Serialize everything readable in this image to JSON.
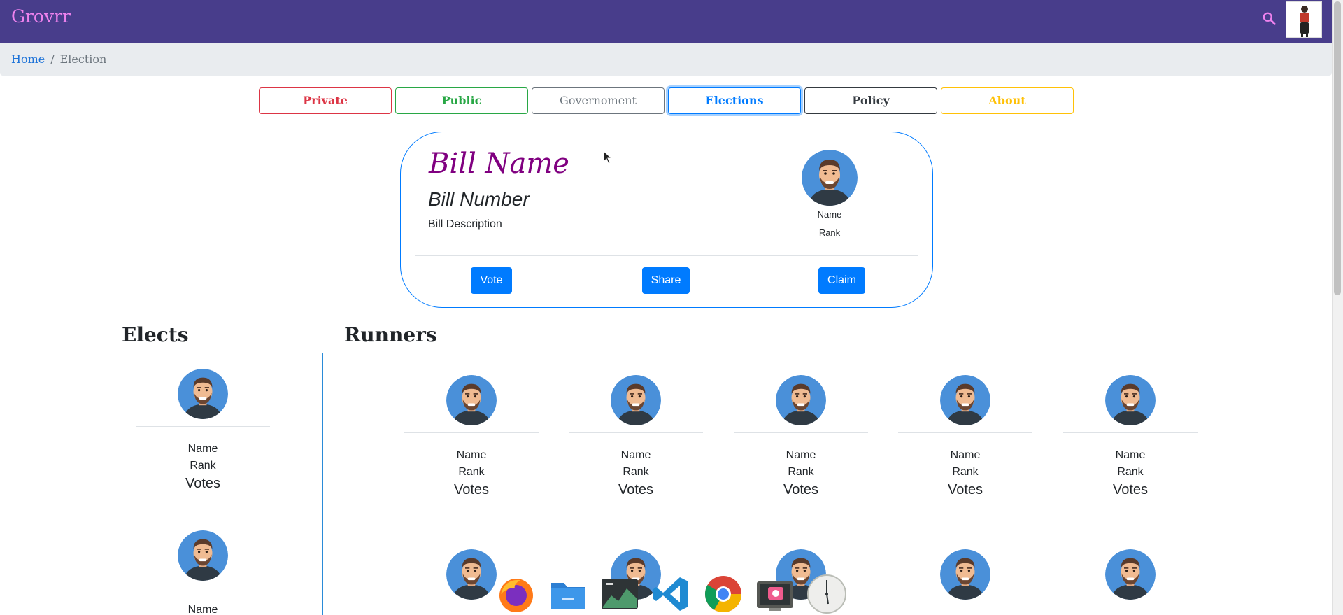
{
  "navbar": {
    "brand": "Grovrr",
    "search_icon": "search-icon",
    "avatar": "user-avatar"
  },
  "breadcrumb": {
    "home": "Home",
    "separator": "/",
    "current": "Election"
  },
  "tabs": [
    {
      "label": "Private",
      "color": "#dc3545"
    },
    {
      "label": "Public",
      "color": "#28a745"
    },
    {
      "label": "Governoment",
      "color": "#6c757d"
    },
    {
      "label": "Elections",
      "color": "#007bff",
      "active": true
    },
    {
      "label": "Policy",
      "color": "#343a40"
    },
    {
      "label": "About",
      "color": "#ffc107"
    }
  ],
  "bill": {
    "name": "Bill Name",
    "number": "Bill Number",
    "description": "Bill Description",
    "author_name": "Name",
    "author_rank": "Rank",
    "buttons": {
      "vote": "Vote",
      "share": "Share",
      "claim": "Claim"
    }
  },
  "sections": {
    "elects": "Elects",
    "runners": "Runners"
  },
  "candidate": {
    "name": "Name",
    "rank": "Rank",
    "votes": "Votes"
  },
  "dock": [
    "firefox-icon",
    "files-icon",
    "system-monitor-icon",
    "vscode-icon",
    "chrome-icon",
    "screenshot-icon",
    "clock-icon"
  ],
  "colors": {
    "navbar": "#483d8b",
    "brand": "#ee82ee",
    "primary": "#007bff",
    "bill_name": "#800080"
  }
}
